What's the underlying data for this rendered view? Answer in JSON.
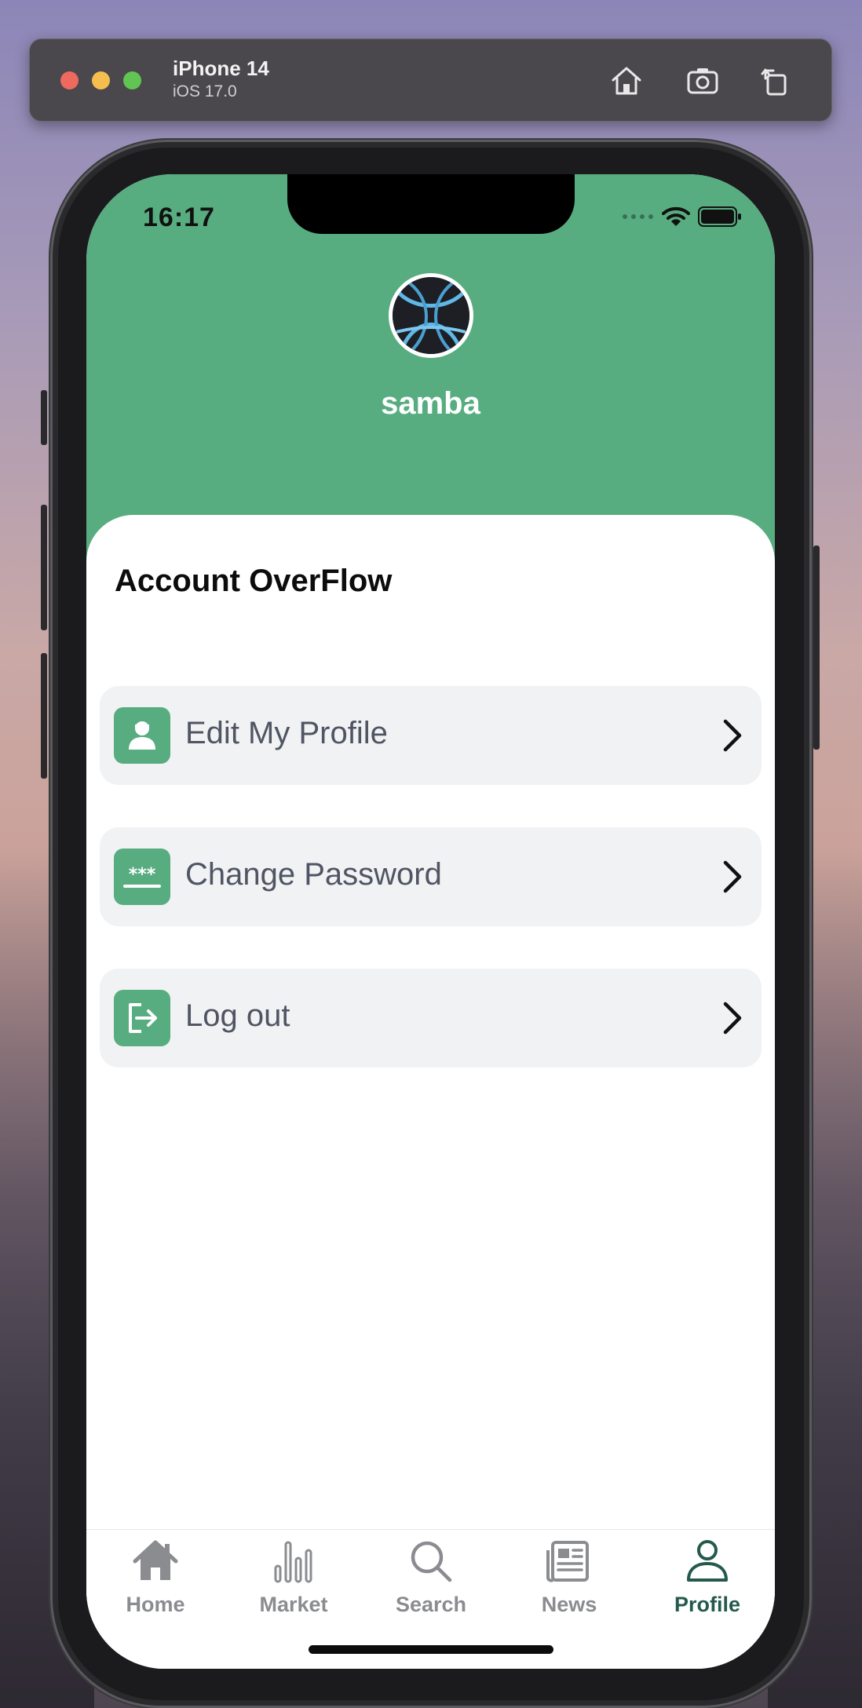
{
  "simulator": {
    "device_name": "iPhone 14",
    "os_version": "iOS 17.0",
    "buttons": [
      "home-icon",
      "screenshot-icon",
      "rotate-icon"
    ]
  },
  "status_bar": {
    "time": "16:17"
  },
  "profile": {
    "username": "samba",
    "avatar_icon": "avatar-image"
  },
  "section": {
    "title": "Account OverFlow"
  },
  "menu": {
    "items": [
      {
        "label": "Edit My Profile",
        "icon": "user-icon"
      },
      {
        "label": "Change Password",
        "icon": "password-icon"
      },
      {
        "label": "Log out",
        "icon": "logout-icon"
      }
    ]
  },
  "tabs": [
    {
      "label": "Home",
      "icon": "home-icon",
      "active": false
    },
    {
      "label": "Market",
      "icon": "chart-bars-icon",
      "active": false
    },
    {
      "label": "Search",
      "icon": "search-icon",
      "active": false
    },
    {
      "label": "News",
      "icon": "newspaper-icon",
      "active": false
    },
    {
      "label": "Profile",
      "icon": "person-icon",
      "active": true
    }
  ],
  "colors": {
    "brand_green": "#58ad80",
    "active_tab": "#245a4d",
    "inactive_tab": "#8b8c90",
    "menu_bg": "#f1f2f4",
    "menu_text": "#4f5562"
  }
}
